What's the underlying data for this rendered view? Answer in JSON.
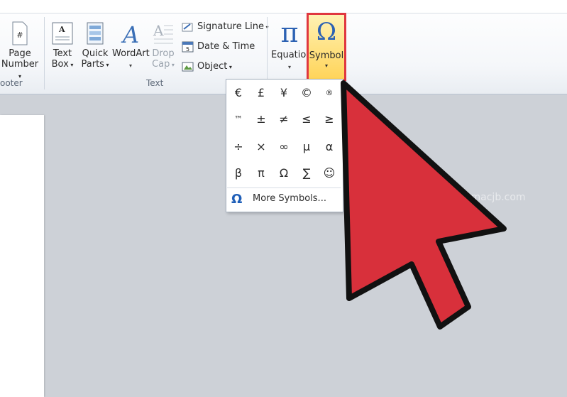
{
  "ribbon": {
    "groups": {
      "footer_partial": "ooter",
      "text": "Text"
    },
    "page_number": {
      "line1": "Page",
      "line2": "Number"
    },
    "text_box": {
      "line1": "Text",
      "line2": "Box"
    },
    "quick_parts": {
      "line1": "Quick",
      "line2": "Parts"
    },
    "wordart": {
      "label": "WordArt"
    },
    "drop_cap": {
      "line1": "Drop",
      "line2": "Cap"
    },
    "signature_line": "Signature Line",
    "date_time": "Date & Time",
    "object": "Object",
    "equation": "Equation",
    "symbol": "Symbol",
    "pi_glyph": "π",
    "omega_glyph": "Ω"
  },
  "symbol_menu": {
    "symbols": [
      "€",
      "£",
      "¥",
      "©",
      "®",
      "™",
      "±",
      "≠",
      "≤",
      "≥",
      "÷",
      "×",
      "∞",
      "µ",
      "α",
      "β",
      "π",
      "Ω",
      "∑",
      "☺"
    ],
    "more_label": "More Symbols...",
    "more_icon": "Ω"
  },
  "colors": {
    "highlight_border": "#e0373f",
    "arrow_fill": "#d8303b"
  },
  "watermark": "www.macjb.com"
}
